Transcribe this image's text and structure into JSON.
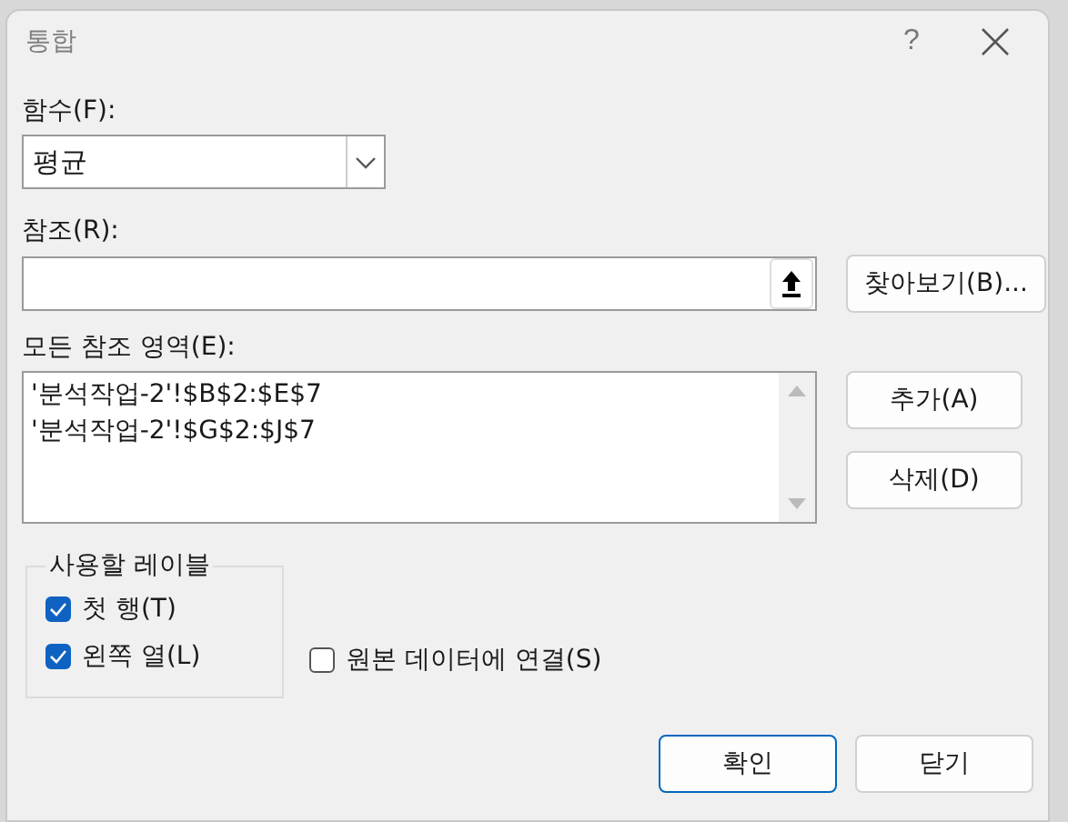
{
  "window": {
    "title": "통합",
    "help": "?"
  },
  "function": {
    "label": "함수(F):",
    "value": "평균"
  },
  "reference": {
    "label": "참조(R):",
    "browse_button": "찾아보기(B)..."
  },
  "all_references": {
    "label": "모든 참조 영역(E):",
    "items": [
      {
        "text": "'분석작업-2'!$B$2:$E$7",
        "selected": false
      },
      {
        "text": "'분석작업-2'!$G$2:$J$7",
        "selected": false
      }
    ],
    "buttons": [
      "추가(A)",
      "삭제(D)"
    ]
  },
  "labels_group": {
    "title": "사용할 레이블",
    "options": [
      {
        "label": "첫 행(T)",
        "checked": true
      },
      {
        "label": "왼쪽 열(L)",
        "checked": true
      }
    ]
  },
  "link_option": {
    "label": "원본 데이터에 연결(S)",
    "checked": false
  },
  "footer_buttons": [
    {
      "label": "확인",
      "default": true
    },
    {
      "label": "닫기",
      "default": false
    }
  ]
}
